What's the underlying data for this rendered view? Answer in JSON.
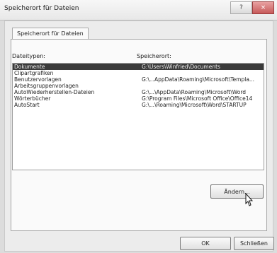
{
  "window": {
    "title": "Speicherort für Dateien",
    "controls": {
      "help": "?",
      "close": "×"
    }
  },
  "tab": {
    "label": "Speicherort für Dateien"
  },
  "columns": {
    "type": "Dateitypen:",
    "location": "Speicherort:"
  },
  "rows": [
    {
      "type": "Dokumente",
      "location": "G:\\Users\\Winfried\\Documents",
      "selected": true
    },
    {
      "type": "Clipartgrafiken",
      "location": "",
      "selected": false
    },
    {
      "type": "Benutzervorlagen",
      "location": "G:\\...AppData\\Roaming\\Microsoft\\Templa...",
      "selected": false
    },
    {
      "type": "Arbeitsgruppenvorlagen",
      "location": "",
      "selected": false
    },
    {
      "type": "AutoWiederherstellen-Dateien",
      "location": "G:\\...\\AppData\\Roaming\\Microsoft\\Word",
      "selected": false
    },
    {
      "type": "Wörterbücher",
      "location": "G:\\Program Files\\Microsoft Office\\Office14",
      "selected": false
    },
    {
      "type": "AutoStart",
      "location": "G:\\...\\Roaming\\Microsoft\\Word\\STARTUP",
      "selected": false
    }
  ],
  "buttons": {
    "change": "Ändern...",
    "ok": "OK",
    "close": "Schließen"
  },
  "colors": {
    "selection": "#3a3a3a",
    "background": "#ececec"
  }
}
